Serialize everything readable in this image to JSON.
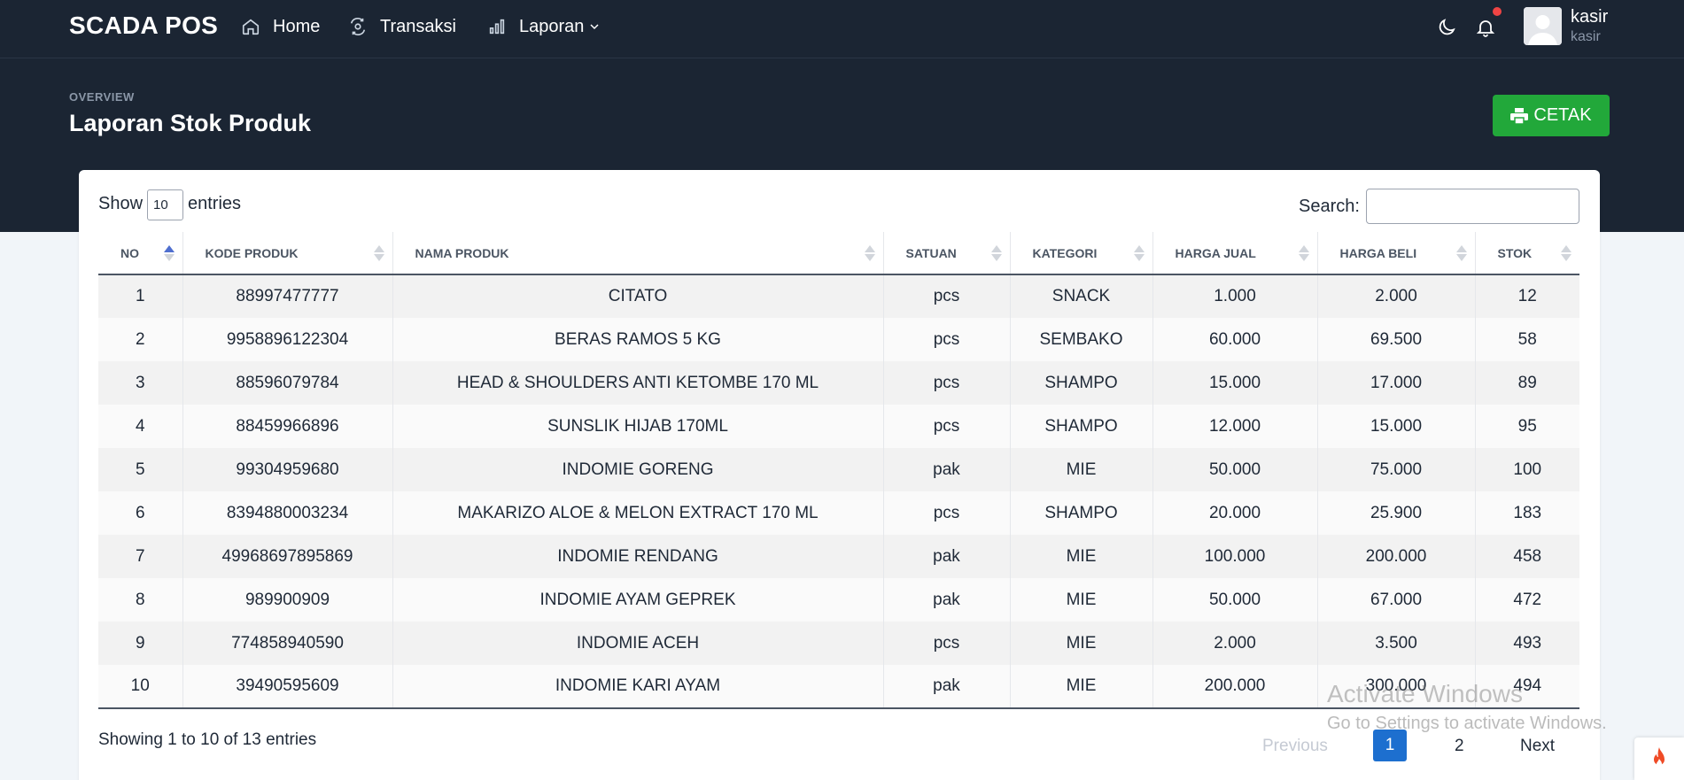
{
  "app": {
    "brand": "SCADA POS"
  },
  "nav": {
    "home": "Home",
    "transaksi": "Transaksi",
    "laporan": "Laporan"
  },
  "user": {
    "name": "kasir",
    "role": "kasir"
  },
  "page": {
    "overline": "OVERVIEW",
    "title": "Laporan Stok Produk",
    "print_label": "CETAK"
  },
  "controls": {
    "show_label": "Show",
    "page_size": "10",
    "entries_label": "entries",
    "search_label": "Search:",
    "search_value": ""
  },
  "table": {
    "headers": [
      "NO",
      "KODE PRODUK",
      "NAMA PRODUK",
      "SATUAN",
      "KATEGORI",
      "HARGA JUAL",
      "HARGA BELI",
      "STOK"
    ],
    "rows": [
      [
        "1",
        "88997477777",
        "CITATO",
        "pcs",
        "SNACK",
        "1.000",
        "2.000",
        "12"
      ],
      [
        "2",
        "9958896122304",
        "BERAS RAMOS 5 KG",
        "pcs",
        "SEMBAKO",
        "60.000",
        "69.500",
        "58"
      ],
      [
        "3",
        "88596079784",
        "HEAD & SHOULDERS ANTI KETOMBE 170 ML",
        "pcs",
        "SHAMPO",
        "15.000",
        "17.000",
        "89"
      ],
      [
        "4",
        "88459966896",
        "SUNSLIK HIJAB 170ML",
        "pcs",
        "SHAMPO",
        "12.000",
        "15.000",
        "95"
      ],
      [
        "5",
        "99304959680",
        "INDOMIE GORENG",
        "pak",
        "MIE",
        "50.000",
        "75.000",
        "100"
      ],
      [
        "6",
        "8394880003234",
        "MAKARIZO ALOE & MELON EXTRACT 170 ML",
        "pcs",
        "SHAMPO",
        "20.000",
        "25.900",
        "183"
      ],
      [
        "7",
        "49968697895869",
        "INDOMIE RENDANG",
        "pak",
        "MIE",
        "100.000",
        "200.000",
        "458"
      ],
      [
        "8",
        "989900909",
        "INDOMIE AYAM GEPREK",
        "pak",
        "MIE",
        "50.000",
        "67.000",
        "472"
      ],
      [
        "9",
        "774858940590",
        "INDOMIE ACEH",
        "pcs",
        "MIE",
        "2.000",
        "3.500",
        "493"
      ],
      [
        "10",
        "39490595609",
        "INDOMIE KARI AYAM",
        "pak",
        "MIE",
        "200.000",
        "300.000",
        "494"
      ]
    ]
  },
  "footer": {
    "info": "Showing 1 to 10 of 13 entries",
    "prev": "Previous",
    "page1": "1",
    "page2": "2",
    "next": "Next"
  },
  "watermark": {
    "line1": "Activate Windows",
    "line2": "Go to Settings to activate Windows."
  },
  "colors": {
    "header_bg": "#1b2533",
    "print_button": "#22a83a",
    "active_page": "#1d6fcf",
    "notification_dot": "#ef4444"
  }
}
